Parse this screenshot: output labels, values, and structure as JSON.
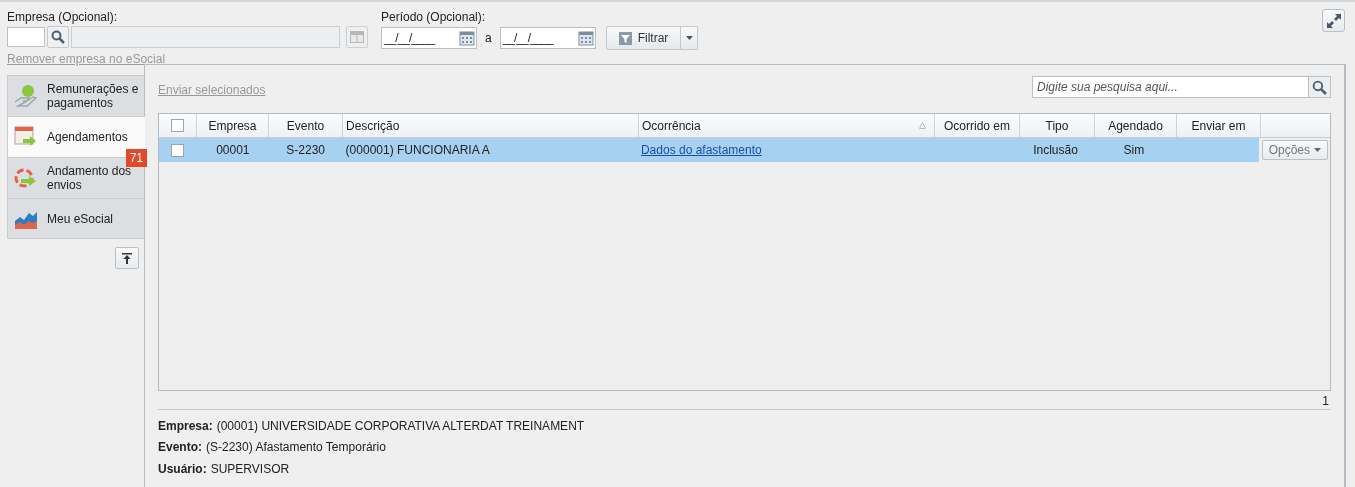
{
  "filters": {
    "empresa": {
      "label": "Empresa (Opcional):"
    },
    "periodo": {
      "label": "Período (Opcional):",
      "from": {
        "value": "__/__/____"
      },
      "separator": "a",
      "to": {
        "value": "__/__/____"
      }
    },
    "filter_button": "Filtrar",
    "remove_link": {
      "label": "Remover empresa no eSocial",
      "disabled": true
    }
  },
  "sidebar": {
    "items": [
      {
        "label": "Remunerações e pagamentos",
        "selected": false
      },
      {
        "label": "Agendamentos",
        "selected": true,
        "badge": "71"
      },
      {
        "label": "Andamento dos envios",
        "selected": false
      },
      {
        "label": "Meu eSocial",
        "selected": false
      }
    ]
  },
  "toolbar": {
    "send_link": {
      "label": "Enviar selecionados",
      "disabled": true
    },
    "search": {
      "placeholder": "Digite sua pesquisa aqui..."
    }
  },
  "table": {
    "select_all": {
      "checked": false
    },
    "columns": [
      {
        "label": "Empresa",
        "sorted": false
      },
      {
        "label": "Evento",
        "sorted": false
      },
      {
        "label": "Descrição",
        "sorted": false
      },
      {
        "label": "Ocorrência",
        "sorted": true
      },
      {
        "label": "Ocorrido em",
        "sorted": false
      },
      {
        "label": "Tipo",
        "sorted": false
      },
      {
        "label": "Agendado",
        "sorted": false
      },
      {
        "label": "Enviar em",
        "sorted": false
      }
    ],
    "rows": [
      {
        "checked": false,
        "selected": true,
        "cells": [
          "00001",
          "S-2230",
          "(000001) FUNCIONARIA A",
          "Dados do afastamento",
          "",
          "Inclusão",
          "Sim",
          ""
        ],
        "options": "Opções"
      }
    ],
    "record_count": "1"
  },
  "details": [
    {
      "label": "Empresa:",
      "value": "(00001) UNIVERSIDADE CORPORATIVA ALTERDAT TREINAMENT"
    },
    {
      "label": "Evento:",
      "value": "(S-2230) Afastamento Temporário"
    },
    {
      "label": "Usuário:",
      "value": "SUPERVISOR"
    }
  ]
}
